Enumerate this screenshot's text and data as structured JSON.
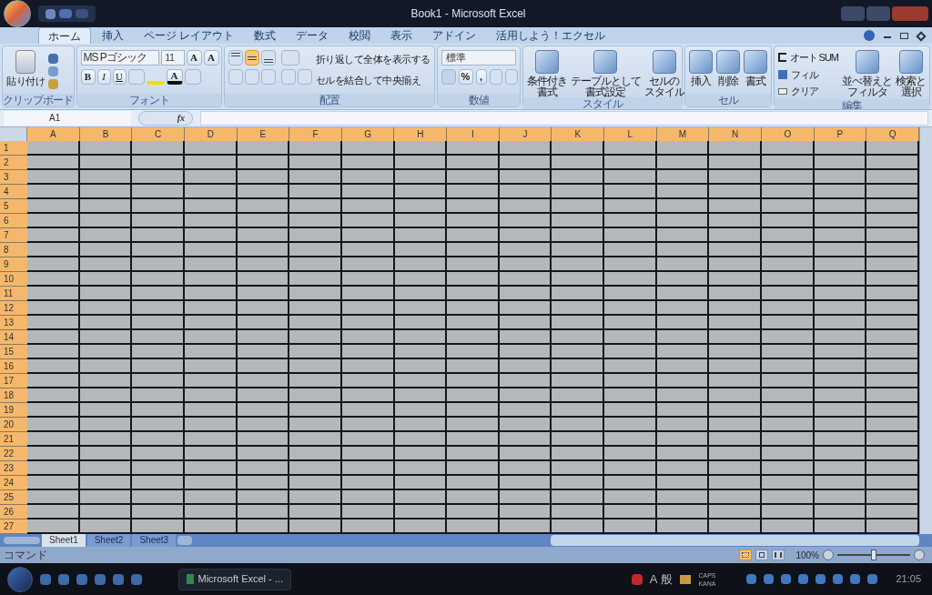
{
  "window": {
    "title": "Book1 - Microsoft Excel"
  },
  "tabs": [
    {
      "label": "ホーム",
      "selected": true
    },
    {
      "label": "挿入",
      "selected": false
    },
    {
      "label": "ページ レイアウト",
      "selected": false
    },
    {
      "label": "数式",
      "selected": false
    },
    {
      "label": "データ",
      "selected": false
    },
    {
      "label": "校閲",
      "selected": false
    },
    {
      "label": "表示",
      "selected": false
    },
    {
      "label": "アドイン",
      "selected": false
    },
    {
      "label": "活用しよう！エクセル",
      "selected": false
    }
  ],
  "clipboard": {
    "paste": "貼り付け",
    "group": "クリップボード"
  },
  "font": {
    "name": "MS Pゴシック",
    "size": "11",
    "grow": "A",
    "shrink": "A",
    "bold": "B",
    "italic": "I",
    "underline": "U",
    "font_color_label": "A",
    "group": "フォント"
  },
  "alignment": {
    "vertical": [
      {
        "kind": "top",
        "selected": false
      },
      {
        "kind": "middle",
        "selected": true
      },
      {
        "kind": "bottom",
        "selected": false
      }
    ],
    "wrap": "折り返して全体を表示する",
    "merge": "セルを結合して中央揃え",
    "group": "配置"
  },
  "number": {
    "format": "標準",
    "percent": "%",
    "comma": ",",
    "group": "数値"
  },
  "styles": {
    "items": [
      [
        "条件付き",
        "書式"
      ],
      [
        "テーブルとして",
        "書式設定"
      ],
      [
        "セルの",
        "スタイル"
      ]
    ],
    "group": "スタイル"
  },
  "cells": {
    "items": [
      "挿入",
      "削除",
      "書式"
    ],
    "group": "セル"
  },
  "editing": {
    "autosum": "オート SUM",
    "fill": "フィル",
    "clear": "クリア",
    "sort": [
      "並べ替えと",
      "フィルタ"
    ],
    "find": [
      "検索と",
      "選択"
    ],
    "group": "編集"
  },
  "formula_bar": {
    "name_box": "A1",
    "fx": "fx"
  },
  "columns": [
    {
      "label": "A",
      "selected": true
    },
    {
      "label": "B",
      "selected": true
    },
    {
      "label": "C",
      "selected": true
    },
    {
      "label": "D",
      "selected": true
    },
    {
      "label": "E",
      "selected": true
    },
    {
      "label": "F",
      "selected": true
    },
    {
      "label": "G",
      "selected": true
    },
    {
      "label": "H",
      "selected": true
    },
    {
      "label": "I",
      "selected": true
    },
    {
      "label": "J",
      "selected": true
    },
    {
      "label": "K",
      "selected": true
    },
    {
      "label": "L",
      "selected": true
    },
    {
      "label": "M",
      "selected": true
    },
    {
      "label": "N",
      "selected": true
    },
    {
      "label": "O",
      "selected": true
    },
    {
      "label": "P",
      "selected": true
    },
    {
      "label": "Q",
      "selected": true
    }
  ],
  "rows": [
    {
      "label": "1",
      "selected": true
    },
    {
      "label": "2",
      "selected": true
    },
    {
      "label": "3",
      "selected": true
    },
    {
      "label": "4",
      "selected": true
    },
    {
      "label": "5",
      "selected": true
    },
    {
      "label": "6",
      "selected": true
    },
    {
      "label": "7",
      "selected": true
    },
    {
      "label": "8",
      "selected": true
    },
    {
      "label": "9",
      "selected": true
    },
    {
      "label": "10",
      "selected": true
    },
    {
      "label": "11",
      "selected": true
    },
    {
      "label": "12",
      "selected": true
    },
    {
      "label": "13",
      "selected": true
    },
    {
      "label": "14",
      "selected": true
    },
    {
      "label": "15",
      "selected": true
    },
    {
      "label": "16",
      "selected": true
    },
    {
      "label": "17",
      "selected": true
    },
    {
      "label": "18",
      "selected": true
    },
    {
      "label": "19",
      "selected": true
    },
    {
      "label": "20",
      "selected": true
    },
    {
      "label": "21",
      "selected": true
    },
    {
      "label": "22",
      "selected": true
    },
    {
      "label": "23",
      "selected": true
    },
    {
      "label": "24",
      "selected": true
    },
    {
      "label": "25",
      "selected": true
    },
    {
      "label": "26",
      "selected": true
    },
    {
      "label": "27",
      "selected": true
    }
  ],
  "sheets": [
    {
      "label": "Sheet1",
      "selected": true
    },
    {
      "label": "Sheet2",
      "selected": false
    },
    {
      "label": "Sheet3",
      "selected": false
    }
  ],
  "status_bar": {
    "mode": "コマンド",
    "views": [
      {
        "kind": "normal",
        "selected": true
      },
      {
        "kind": "layout",
        "selected": false
      },
      {
        "kind": "pagebreak",
        "selected": false
      }
    ],
    "zoom": "100%",
    "zoom_slider": {
      "level": 0.5
    }
  },
  "taskbar": {
    "window": "Microsoft Excel - ...",
    "ime_mode": "A",
    "ime_kana": "般",
    "caps": "CAPS",
    "kana": "KANA",
    "clock": "21:05"
  }
}
